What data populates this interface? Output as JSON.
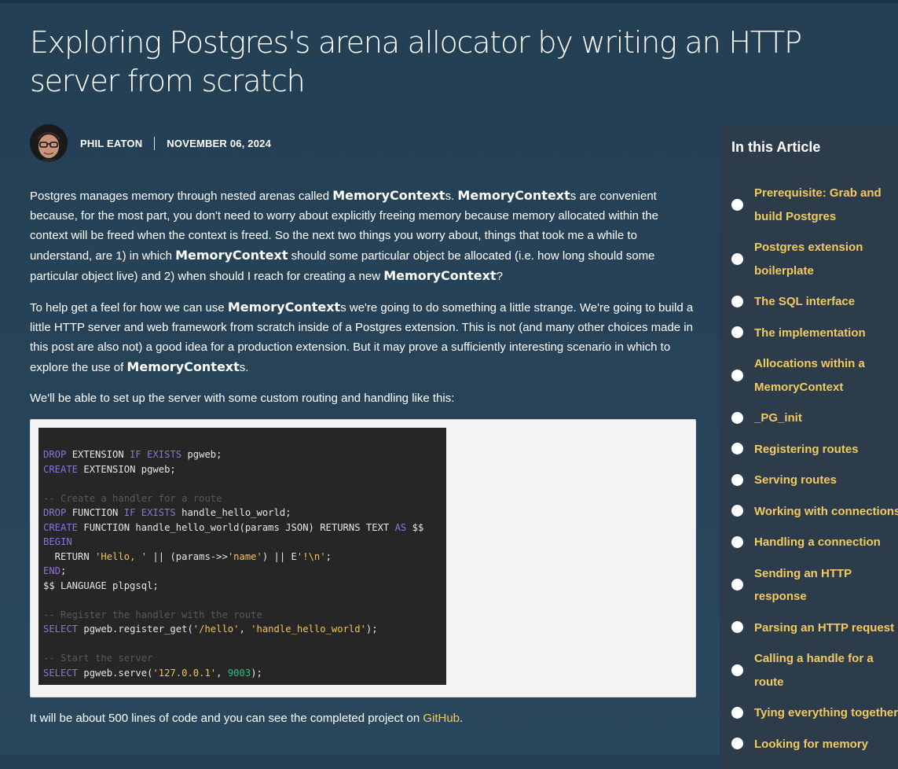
{
  "article": {
    "title": "Exploring Postgres's arena allocator by writing an HTTP server from scratch",
    "author": "PHIL EATON",
    "date": "NOVEMBER 06, 2024"
  },
  "intro": {
    "p1": {
      "a": "Postgres manages memory through nested arenas called ",
      "mc1": "MemoryContext",
      "b": "s. ",
      "mc2": "MemoryContext",
      "c": "s are convenient because, for the most part, you don't need to worry about explicitly freeing memory because memory allocated within the context will be freed when the context is freed. So the next two things you worry about, things that took me a while to understand, are 1) in which ",
      "mc3": "MemoryContext",
      "d": " should some particular object be allocated (i.e. how long should some particular object live) and 2) when should I reach for creating a new ",
      "mc4": "MemoryContext",
      "e": "?"
    },
    "p2": {
      "a": "To help get a feel for how we can use ",
      "mc1": "MemoryContext",
      "b": "s we're going to do something a little strange. We're going to build a little HTTP server and web framework from scratch inside of a Postgres extension. This is not (and many other choices made in this post are also not) a good idea for a production extension. But it may prove a sufficiently interesting scenario in which to explore the use of ",
      "mc2": "MemoryContext",
      "c": "s."
    },
    "p3": "We'll be able to set up the server with some custom routing and handling like this:",
    "p4": {
      "a": "It will be about 500 lines of code and you can see the completed project on ",
      "link": "GitHub",
      "b": "."
    }
  },
  "code": {
    "l1": {
      "k1": "DROP",
      "t1": " EXTENSION ",
      "k2": "IF EXISTS",
      "t2": " pgweb;"
    },
    "l2": {
      "k1": "CREATE",
      "t1": " EXTENSION pgweb;"
    },
    "l3": "-- Create a handler for a route",
    "l4": {
      "k1": "DROP",
      "t1": " FUNCTION ",
      "k2": "IF EXISTS",
      "t2": " handle_hello_world;"
    },
    "l5": {
      "k1": "CREATE",
      "t1": " FUNCTION handle_hello_world(params JSON) RETURNS TEXT ",
      "k2": "AS",
      "t2": " $$"
    },
    "l6": "BEGIN",
    "l7": {
      "t1": "  RETURN ",
      "s1": "'Hello, '",
      "t2": " || (params->>",
      "s2": "'name'",
      "t3": ") || E",
      "s3": "'!\\n'",
      "t4": ";"
    },
    "l8": {
      "k1": "END",
      "t1": ";"
    },
    "l9": "$$ LANGUAGE plpgsql;",
    "l10": "-- Register the handler with the route",
    "l11": {
      "k1": "SELECT",
      "t1": " pgweb.register_get(",
      "s1": "'/hello'",
      "t2": ", ",
      "s2": "'handle_hello_world'",
      "t3": ");"
    },
    "l12": "-- Start the server",
    "l13": {
      "k1": "SELECT",
      "t1": " pgweb.serve(",
      "s1": "'127.0.0.1'",
      "t2": ", ",
      "n1": "9003",
      "t3": ");"
    }
  },
  "toc": {
    "heading": "In this Article",
    "items": [
      "Prerequisite: Grab and build Postgres",
      "Postgres extension boilerplate",
      "The SQL interface",
      "The implementation",
      "Allocations within a MemoryContext",
      "_PG_init",
      "Registering routes",
      "Serving routes",
      "Working with connections",
      "Handling a connection",
      "Sending an HTTP response",
      "Parsing an HTTP request",
      "Calling a handle for a route",
      "Tying everything together",
      "Looking for memory"
    ]
  },
  "colors": {
    "background": "#274359",
    "link": "#f2ca62",
    "toc_background": "#2c3c4a",
    "code_keyword": "#8d72d8",
    "code_string": "#f5c451",
    "code_number": "#26c281"
  },
  "icons": {
    "toc_bullet": "circle-bullet-icon"
  }
}
